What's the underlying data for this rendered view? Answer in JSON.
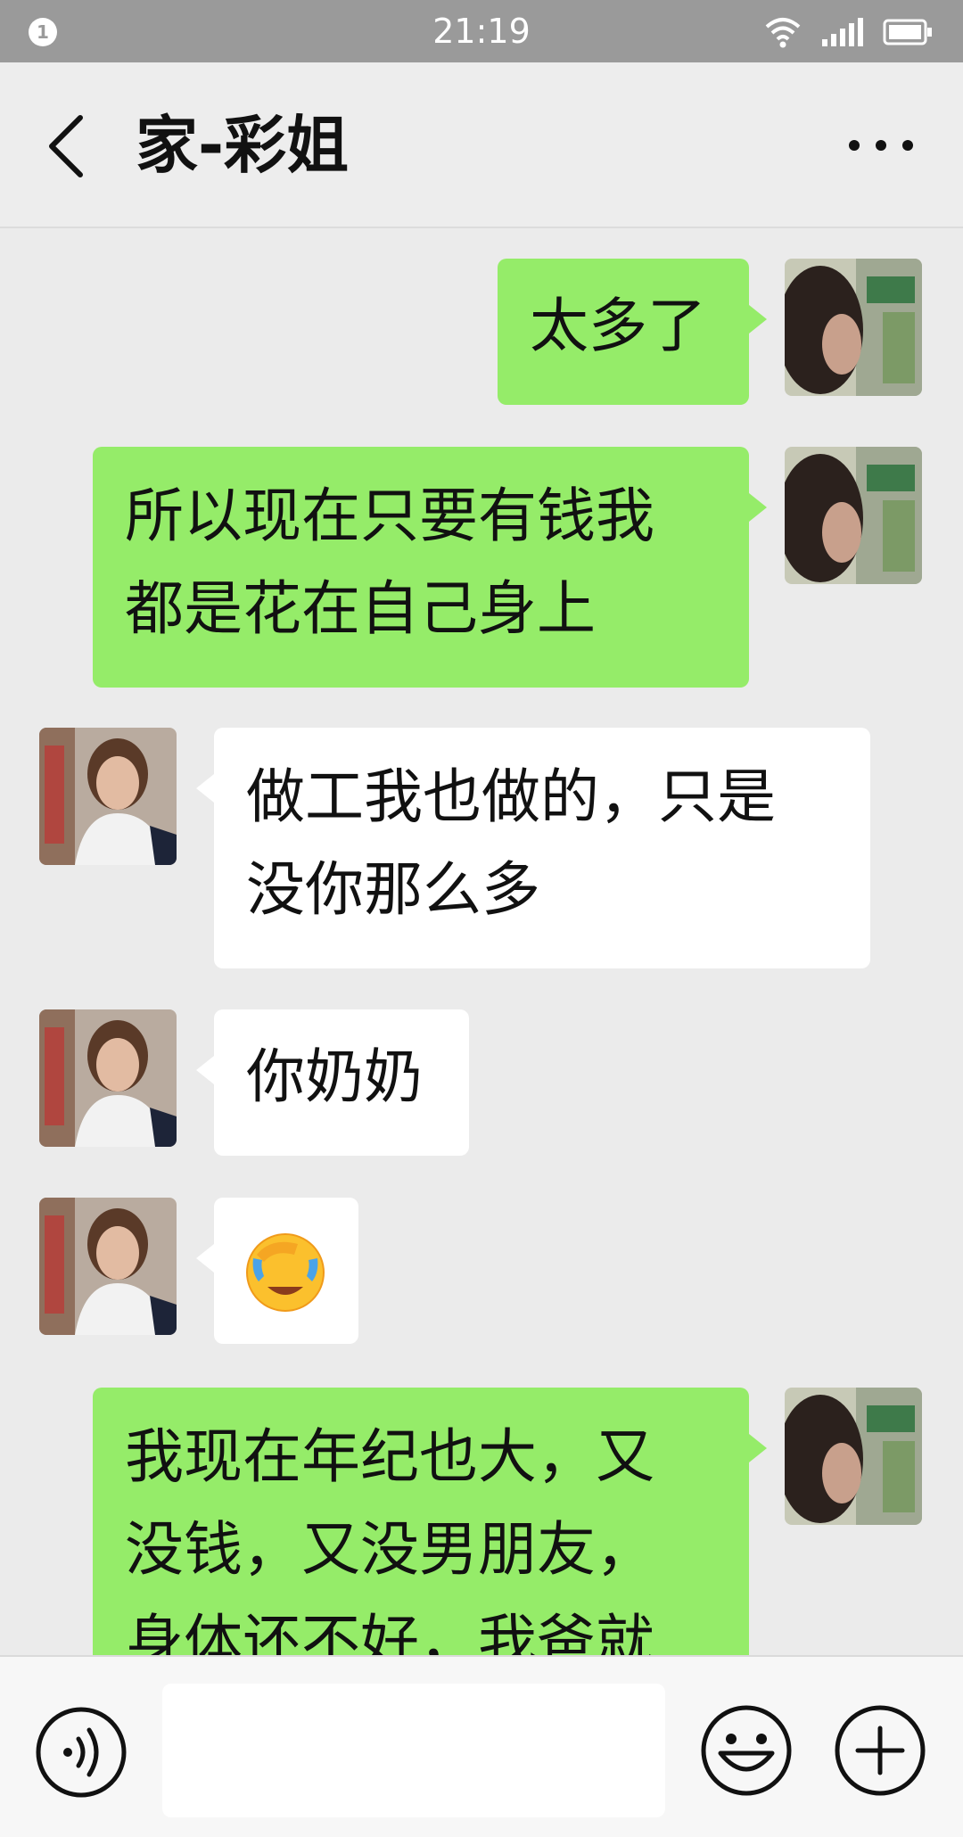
{
  "status_bar": {
    "notification_count": "1",
    "time": "21:19",
    "icons": [
      "wifi-icon",
      "signal-icon",
      "battery-icon"
    ]
  },
  "header": {
    "back_icon": "chevron-left-icon",
    "title": "家-彩姐",
    "more_icon": "more-dots-icon"
  },
  "messages": [
    {
      "sender": "me",
      "lines": [
        "太多了"
      ]
    },
    {
      "sender": "me",
      "lines": [
        "所以现在只要有钱我",
        "都是花在自己身上"
      ]
    },
    {
      "sender": "other",
      "lines": [
        "做工我也做的，只是",
        "没你那么多"
      ]
    },
    {
      "sender": "other",
      "lines": [
        "你奶奶"
      ]
    },
    {
      "sender": "other",
      "emoji": "facepalm-crying-emoji"
    },
    {
      "sender": "me",
      "lines": [
        "我现在年纪也大，又",
        "没钱，又没男朋友，",
        "身体还不好，我爸就"
      ]
    }
  ],
  "input_bar": {
    "voice_icon": "voice-icon",
    "message_value": "",
    "emoji_icon": "smiley-icon",
    "plus_icon": "plus-icon"
  },
  "colors": {
    "background": "#ebebeb",
    "sent_bubble": "#95ec69",
    "received_bubble": "#ffffff",
    "status_bar": "#9a9a9a"
  }
}
